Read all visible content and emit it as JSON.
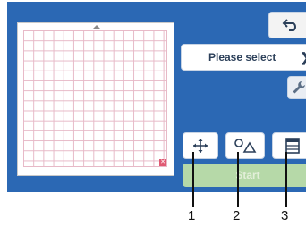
{
  "screen": {
    "select_label": "Please select",
    "start_label": "Start",
    "icons": {
      "back": "back-arrow-icon",
      "chevron": "chevron-right-icon",
      "wrench": "wrench-icon",
      "move": "move-arrows-icon",
      "shape": "shape-circle-triangle-icon",
      "grid": "mat-view-icon"
    }
  },
  "callouts": [
    "1",
    "2",
    "3"
  ],
  "colors": {
    "screen_bg": "#2b68b4",
    "grid_lines": "#e7b9c7",
    "start_disabled": "#b6d9a8",
    "callout_line": "#111111"
  }
}
